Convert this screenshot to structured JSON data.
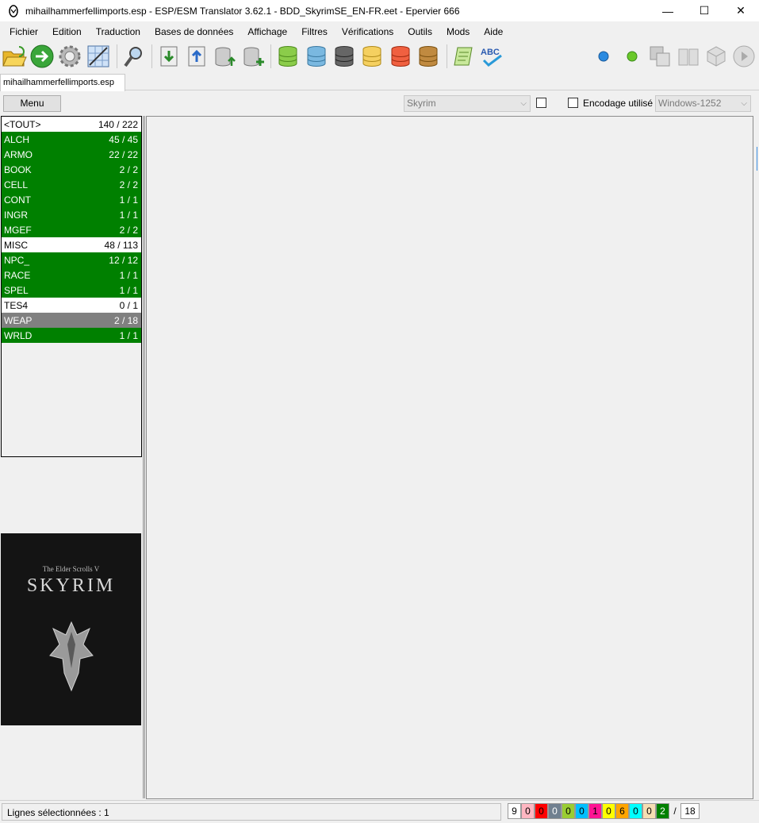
{
  "window": {
    "title": "mihailhammerfellimports.esp - ESP/ESM Translator 3.62.1 - BDD_SkyrimSE_EN-FR.eet - Epervier 666",
    "minimize": "—",
    "maximize": "☐",
    "close": "✕"
  },
  "menu": [
    "Fichier",
    "Edition",
    "Traduction",
    "Bases de données",
    "Affichage",
    "Filtres",
    "Vérifications",
    "Outils",
    "Mods",
    "Aide"
  ],
  "tab": {
    "label": "mihailhammerfellimports.esp"
  },
  "menu_button": "Menu",
  "game_select": {
    "value": "Skyrim"
  },
  "encoding": {
    "label": "Encodage utilisé",
    "value": "Windows-1252"
  },
  "records": [
    {
      "name": "<TOUT>",
      "count": "140 / 222",
      "color": "white"
    },
    {
      "name": "ALCH",
      "count": "45 / 45",
      "color": "green"
    },
    {
      "name": "ARMO",
      "count": "22 / 22",
      "color": "green"
    },
    {
      "name": "BOOK",
      "count": "2 / 2",
      "color": "green"
    },
    {
      "name": "CELL",
      "count": "2 / 2",
      "color": "green"
    },
    {
      "name": "CONT",
      "count": "1 / 1",
      "color": "green"
    },
    {
      "name": "INGR",
      "count": "1 / 1",
      "color": "green"
    },
    {
      "name": "MGEF",
      "count": "2 / 2",
      "color": "green"
    },
    {
      "name": "MISC",
      "count": "48 / 113",
      "color": "white"
    },
    {
      "name": "NPC_",
      "count": "12 / 12",
      "color": "green"
    },
    {
      "name": "RACE",
      "count": "1 / 1",
      "color": "green"
    },
    {
      "name": "SPEL",
      "count": "1 / 1",
      "color": "green"
    },
    {
      "name": "TES4",
      "count": "0 / 1",
      "color": "white"
    },
    {
      "name": "WEAP",
      "count": "2 / 18",
      "color": "gray"
    },
    {
      "name": "WRLD",
      "count": "1 / 1",
      "color": "green"
    }
  ],
  "cover": {
    "subtitle": "The Elder Scrolls V",
    "title": "SKYRIM"
  },
  "status": {
    "label": "Lignes sélectionnées :",
    "value": "1",
    "counters": [
      {
        "v": "9",
        "bg": "#ffffff",
        "fg": "#000000"
      },
      {
        "v": "0",
        "bg": "#ffb6c1",
        "fg": "#000000"
      },
      {
        "v": "0",
        "bg": "#ff0000",
        "fg": "#000000"
      },
      {
        "v": "0",
        "bg": "#708090",
        "fg": "#ffffff"
      },
      {
        "v": "0",
        "bg": "#9acd32",
        "fg": "#000000"
      },
      {
        "v": "0",
        "bg": "#00bfff",
        "fg": "#000000"
      },
      {
        "v": "1",
        "bg": "#ff1493",
        "fg": "#000000"
      },
      {
        "v": "0",
        "bg": "#ffff00",
        "fg": "#000000"
      },
      {
        "v": "6",
        "bg": "#ffa500",
        "fg": "#000000"
      },
      {
        "v": "0",
        "bg": "#00ffff",
        "fg": "#000000"
      },
      {
        "v": "0",
        "bg": "#f5deb3",
        "fg": "#000000"
      },
      {
        "v": "2",
        "bg": "#008000",
        "fg": "#ffffff"
      }
    ],
    "slash": "/",
    "total": "18"
  },
  "toolbar": [
    "open-folder-icon",
    "forward-arrow-icon",
    "gear-icon",
    "grid-icon",
    "search-tool-icon",
    "import-icon",
    "export-icon",
    "db-upload-icon",
    "db-add-icon",
    "db-green-icon",
    "db-blue-icon",
    "db-black-icon",
    "db-yellow-icon",
    "db-red-icon",
    "db-brown-icon",
    "script-icon",
    "spellcheck-icon",
    "blue-dot-icon",
    "green-dot-icon",
    "compare-icon",
    "book-icon",
    "cube-icon",
    "play-icon"
  ]
}
